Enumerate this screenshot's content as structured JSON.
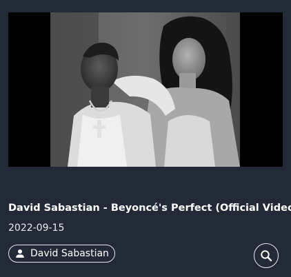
{
  "video": {
    "title": "David Sabastian - Beyoncé's Perfect (Official Video)",
    "date": "2022-09-15",
    "artist": "David Sabastian",
    "thumbnail_alt": "David Sabastian - Beyoncé's Perfect (Official Video) thumbnail"
  },
  "icons": {
    "artist": "person-icon",
    "search": "search-icon"
  },
  "colors": {
    "background": "#222a37",
    "text": "#ffffff",
    "outline": "#e6e8ec"
  }
}
